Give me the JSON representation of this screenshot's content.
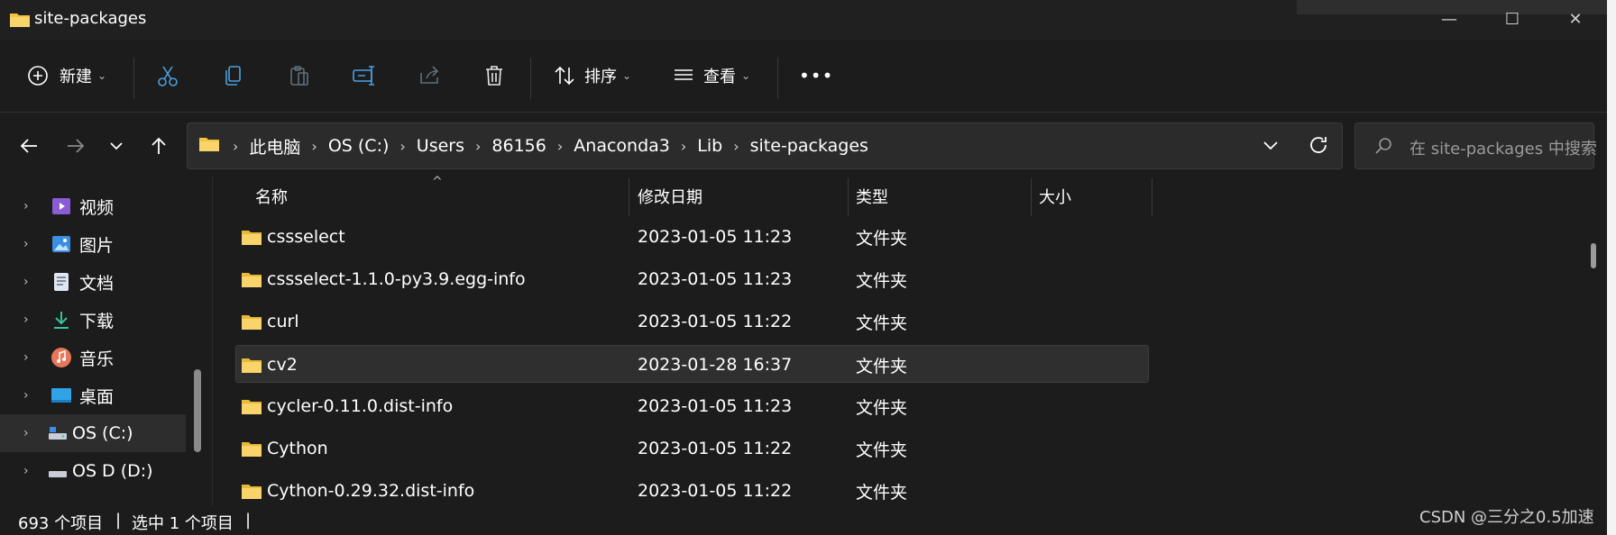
{
  "window": {
    "title": "site-packages",
    "minimize": "—",
    "maximize": "☐",
    "close": "✕"
  },
  "toolbar": {
    "new_label": "新建",
    "sort_label": "排序",
    "view_label": "查看",
    "more_label": "•••"
  },
  "address": {
    "crumbs": [
      "此电脑",
      "OS (C:)",
      "Users",
      "86156",
      "Anaconda3",
      "Lib",
      "site-packages"
    ]
  },
  "search": {
    "placeholder": "在 site-packages 中搜索"
  },
  "sidebar": {
    "items": [
      {
        "label": "视频",
        "icon": "video-icon"
      },
      {
        "label": "图片",
        "icon": "pictures-icon"
      },
      {
        "label": "文档",
        "icon": "documents-icon"
      },
      {
        "label": "下载",
        "icon": "downloads-icon"
      },
      {
        "label": "音乐",
        "icon": "music-icon"
      },
      {
        "label": "桌面",
        "icon": "desktop-icon"
      },
      {
        "label": "OS (C:)",
        "icon": "drive-icon"
      },
      {
        "label": "OS D (D:)",
        "icon": "drive-icon"
      }
    ]
  },
  "columns": {
    "name": "名称",
    "modified": "修改日期",
    "type": "类型",
    "size": "大小"
  },
  "files": [
    {
      "name": "cssselect",
      "modified": "2023-01-05 11:23",
      "type": "文件夹"
    },
    {
      "name": "cssselect-1.1.0-py3.9.egg-info",
      "modified": "2023-01-05 11:23",
      "type": "文件夹"
    },
    {
      "name": "curl",
      "modified": "2023-01-05 11:22",
      "type": "文件夹"
    },
    {
      "name": "cv2",
      "modified": "2023-01-28 16:37",
      "type": "文件夹"
    },
    {
      "name": "cycler-0.11.0.dist-info",
      "modified": "2023-01-05 11:23",
      "type": "文件夹"
    },
    {
      "name": "Cython",
      "modified": "2023-01-05 11:22",
      "type": "文件夹"
    },
    {
      "name": "Cython-0.29.32.dist-info",
      "modified": "2023-01-05 11:22",
      "type": "文件夹"
    }
  ],
  "status": {
    "count": "693 个项目",
    "selected": "选中 1 个项目",
    "sep": "|"
  },
  "watermark": "CSDN @三分之0.5加速",
  "colors": {
    "background": "#1c1c1c",
    "selected_row": "#2f2f2f",
    "folder_yellow": "#f5c342",
    "accent_blue": "#4ca0e0"
  }
}
